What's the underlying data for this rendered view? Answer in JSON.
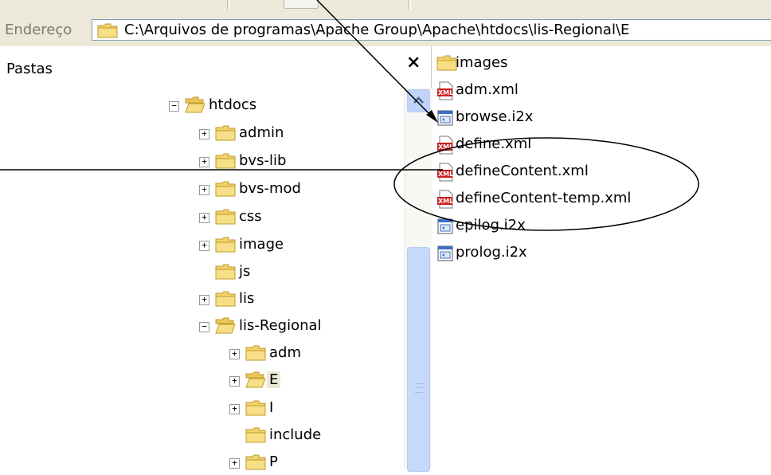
{
  "address_bar": {
    "label": "Endereço",
    "value": "C:\\Arquivos de programas\\Apache Group\\Apache\\htdocs\\lis-Regional\\E"
  },
  "folders_pane": {
    "title": "Pastas",
    "close_label": "×",
    "tree": [
      {
        "label": "htdocs",
        "expander": "−",
        "open": true
      },
      {
        "label": "admin",
        "expander": "+"
      },
      {
        "label": "bvs-lib",
        "expander": "+"
      },
      {
        "label": "bvs-mod",
        "expander": "+"
      },
      {
        "label": "css",
        "expander": "+"
      },
      {
        "label": "image",
        "expander": "+"
      },
      {
        "label": "js",
        "expander": ""
      },
      {
        "label": "lis",
        "expander": "+"
      },
      {
        "label": "lis-Regional",
        "expander": "−",
        "open": true
      },
      {
        "label": "adm",
        "expander": "+"
      },
      {
        "label": "E",
        "expander": "+",
        "open": true,
        "selected": true
      },
      {
        "label": "I",
        "expander": "+"
      },
      {
        "label": "include",
        "expander": ""
      },
      {
        "label": "P",
        "expander": "+"
      }
    ]
  },
  "files_pane": {
    "items": [
      {
        "label": "images",
        "icon": "folder-icon"
      },
      {
        "label": "adm.xml",
        "icon": "xml-file-icon"
      },
      {
        "label": "browse.i2x",
        "icon": "i2x-file-icon"
      },
      {
        "label": "define.xml",
        "icon": "xml-file-icon"
      },
      {
        "label": "defineContent.xml",
        "icon": "xml-file-icon"
      },
      {
        "label": "defineContent-temp.xml",
        "icon": "xml-file-icon"
      },
      {
        "label": "epilog.i2x",
        "icon": "i2x-file-icon"
      },
      {
        "label": "prolog.i2x",
        "icon": "i2x-file-icon"
      }
    ]
  },
  "colors": {
    "folder": "#f1d36b",
    "folder_edge": "#c29a2b",
    "xml_red": "#cc1f1f",
    "scroll_blue": "#c1d3fb"
  }
}
